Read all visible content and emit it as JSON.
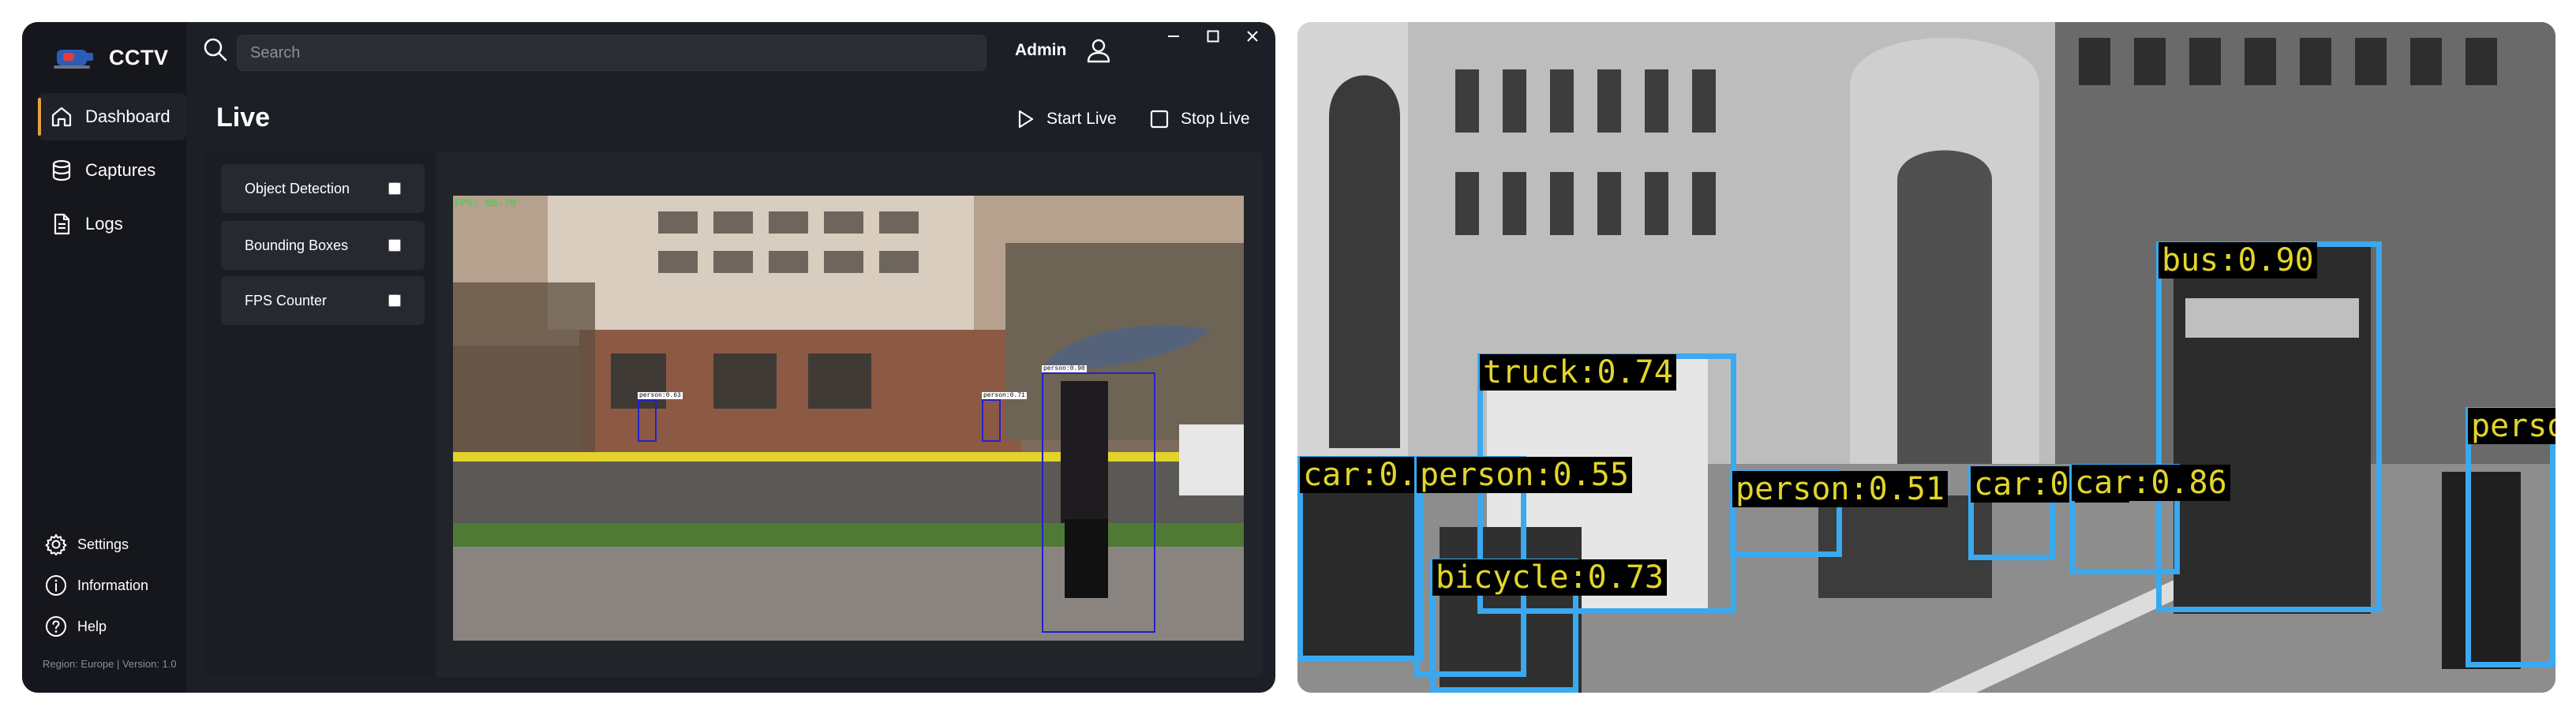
{
  "app": {
    "title": "CCTV",
    "region_version": "Region: Europe | Version: 1.0"
  },
  "sidebar": {
    "items": [
      {
        "label": "Dashboard",
        "icon": "home-icon",
        "active": true
      },
      {
        "label": "Captures",
        "icon": "database-icon",
        "active": false
      },
      {
        "label": "Logs",
        "icon": "document-icon",
        "active": false
      }
    ],
    "bottom": [
      {
        "label": "Settings",
        "icon": "gear-icon"
      },
      {
        "label": "Information",
        "icon": "info-icon"
      },
      {
        "label": "Help",
        "icon": "help-icon"
      }
    ]
  },
  "topbar": {
    "search_placeholder": "Search",
    "user": "Admin"
  },
  "main": {
    "title": "Live",
    "start_label": "Start Live",
    "stop_label": "Stop Live",
    "options": [
      {
        "label": "Object Detection",
        "checked": false
      },
      {
        "label": "Bounding Boxes",
        "checked": false
      },
      {
        "label": "FPS Counter",
        "checked": false
      }
    ],
    "feed": {
      "fps_text": "FPS: 65.70",
      "detections": [
        {
          "label": "person:0.63"
        },
        {
          "label": "person:0.71"
        },
        {
          "label": "person:0.90"
        }
      ]
    }
  },
  "detections": [
    {
      "label": "truck:0.74"
    },
    {
      "label": "bus:0.90"
    },
    {
      "label": "car:0.8"
    },
    {
      "label": "person:0.55"
    },
    {
      "label": "person:0.51"
    },
    {
      "label": "car:0.57"
    },
    {
      "label": "car:0.86"
    },
    {
      "label": "bicycle:0.73"
    },
    {
      "label": "perso"
    }
  ],
  "colors": {
    "accent": "#e3a23c",
    "box_blue": "#3aa9f0",
    "label_yellow": "#e2d52b",
    "feed_box": "#2222cc"
  }
}
